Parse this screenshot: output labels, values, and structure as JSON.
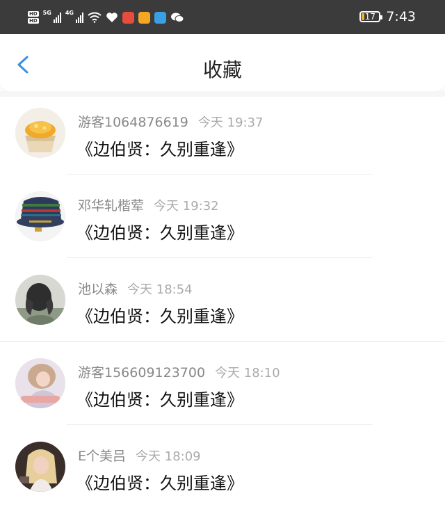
{
  "status_bar": {
    "hd1": "HD",
    "hd2": "HD",
    "net1": "5G",
    "net2": "4G",
    "battery": "17",
    "time": "7:43",
    "app_icon_colors": [
      "#e74c3c",
      "#f5a623",
      "#3aa0e6"
    ]
  },
  "header": {
    "title": "收藏",
    "back_icon": "chevron-left-icon",
    "accent": "#3b8fe0"
  },
  "items": [
    {
      "user": "游客1064876619",
      "time": "今天 19:37",
      "work": "《边伯贤：久别重逢》"
    },
    {
      "user": "邓华轧楷荤",
      "time": "今天 19:32",
      "work": "《边伯贤：久别重逢》"
    },
    {
      "user": "池以森",
      "time": "今天 18:54",
      "work": "《边伯贤：久别重逢》"
    },
    {
      "user": "游客156609123700",
      "time": "今天 18:10",
      "work": "《边伯贤：久别重逢》"
    },
    {
      "user": "E个美吕",
      "time": "今天 18:09",
      "work": "《边伯贤：久别重逢》"
    }
  ]
}
